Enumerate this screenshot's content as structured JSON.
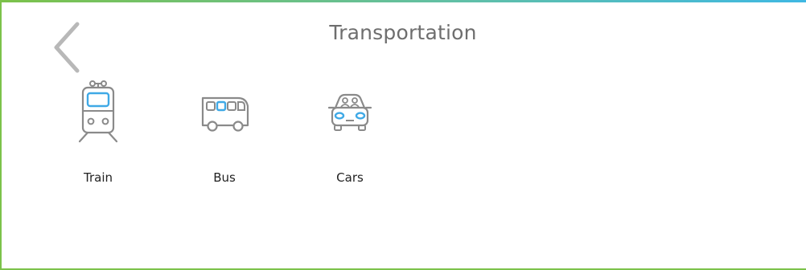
{
  "header": {
    "title": "Transportation",
    "back_icon": "chevron-left-icon"
  },
  "items": [
    {
      "label": "Train",
      "icon": "train-icon"
    },
    {
      "label": "Bus",
      "icon": "bus-icon"
    },
    {
      "label": "Cars",
      "icon": "car-icon"
    }
  ],
  "colors": {
    "accent_blue": "#3fa9e6",
    "icon_gray": "#8a8a8a",
    "border_green": "#7cc24a",
    "border_blue": "#3fb8e3",
    "title_gray": "#6e6e6e"
  }
}
